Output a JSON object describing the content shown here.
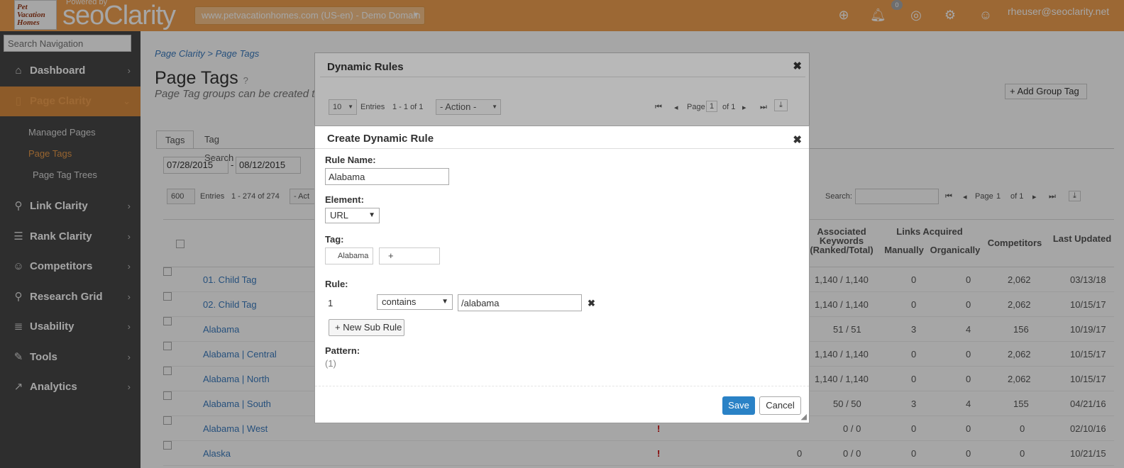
{
  "header": {
    "logo_text": "Pet Vacation Homes",
    "powered_by": "Powered by",
    "brand": "seoClarity",
    "domain": "www.petvacationhomes.com (US-en) - Demo Domain",
    "notification_count": "0",
    "user_email": "rheuser@seoclarity.net",
    "icons": [
      "plus-circle-icon",
      "bell-icon",
      "support-icon",
      "gear-icon",
      "user-icon"
    ]
  },
  "sidebar": {
    "search_placeholder": "Search Navigation",
    "items": [
      {
        "label": "Dashboard",
        "icon": "home-icon"
      },
      {
        "label": "Page Clarity",
        "icon": "page-icon",
        "active": true
      },
      {
        "label": "Link Clarity",
        "icon": "link-icon"
      },
      {
        "label": "Rank Clarity",
        "icon": "list-icon"
      },
      {
        "label": "Competitors",
        "icon": "users-icon"
      },
      {
        "label": "Research Grid",
        "icon": "search-icon"
      },
      {
        "label": "Usability",
        "icon": "database-icon"
      },
      {
        "label": "Tools",
        "icon": "wrench-icon"
      },
      {
        "label": "Analytics",
        "icon": "chart-icon"
      }
    ],
    "sub_items": [
      {
        "label": "Managed Pages"
      },
      {
        "label": "Page Tags",
        "active": true
      },
      {
        "label": "Page Tag Trees"
      }
    ]
  },
  "main": {
    "breadcrumb": "Page Clarity > Page Tags",
    "title": "Page Tags",
    "subtitle": "Page Tag groups can be created t",
    "add_group_label": "+ Add Group Tag",
    "tabs": [
      "Tags",
      "Tag Search"
    ],
    "date_from": "07/28/2015",
    "date_to": "08/12/2015",
    "date_sep": "-",
    "grid_entries_select": "600",
    "grid_entries_label": "Entries",
    "grid_range": "1 - 274 of 274",
    "grid_action": "- Act",
    "grid_search_label": "Search:",
    "grid_page_label": "Page",
    "grid_page": "1",
    "grid_of": "of 1",
    "columns": {
      "assoc_keywords": "Associated Keywords (Ranked/Total)",
      "links_acquired": "Links Acquired",
      "manually": "Manually",
      "organically": "Organically",
      "competitors": "Competitors",
      "last_updated": "Last Updated"
    },
    "rows": [
      {
        "name": "01. Child Tag",
        "flag": "",
        "assoc": "1,140 / 1,140",
        "manual": "0",
        "organic": "0",
        "competitors": "2,062",
        "updated": "03/13/18"
      },
      {
        "name": "02. Child Tag",
        "flag": "",
        "assoc": "1,140 / 1,140",
        "manual": "0",
        "organic": "0",
        "competitors": "2,062",
        "updated": "10/15/17"
      },
      {
        "name": "Alabama",
        "flag": "",
        "assoc": "51 / 51",
        "manual": "3",
        "organic": "4",
        "competitors": "156",
        "updated": "10/19/17"
      },
      {
        "name": "Alabama | Central",
        "flag": "",
        "assoc": "1,140 / 1,140",
        "manual": "0",
        "organic": "0",
        "competitors": "2,062",
        "updated": "10/15/17"
      },
      {
        "name": "Alabama | North",
        "flag": "",
        "assoc": "1,140 / 1,140",
        "manual": "0",
        "organic": "0",
        "competitors": "2,062",
        "updated": "10/15/17"
      },
      {
        "name": "Alabama | South",
        "flag": "",
        "assoc": "50 / 50",
        "manual": "3",
        "organic": "4",
        "competitors": "155",
        "updated": "04/21/16"
      },
      {
        "name": "Alabama | West",
        "flag": "!",
        "assoc": "0 / 0",
        "manual": "0",
        "organic": "0",
        "competitors": "0",
        "updated": "02/10/16"
      },
      {
        "name": "Alaska",
        "flag": "!",
        "extra": "0",
        "assoc": "0 / 0",
        "manual": "0",
        "organic": "0",
        "competitors": "0",
        "updated": "10/21/15"
      }
    ]
  },
  "dynamic_rules_modal": {
    "title": "Dynamic Rules",
    "entries_select": "10",
    "entries_label": "Entries",
    "range": "1 - 1 of 1",
    "action_select": "- Action -",
    "page_label": "Page",
    "page": "1",
    "of_label": "of 1"
  },
  "create_rule_modal": {
    "title": "Create Dynamic Rule",
    "rule_name_label": "Rule Name:",
    "rule_name_value": "Alabama",
    "element_label": "Element:",
    "element_value": "URL",
    "tag_label": "Tag:",
    "tag_value": "Alabama",
    "tag_add": "+",
    "rule_label": "Rule:",
    "rule_number": "1",
    "rule_operator": "contains",
    "rule_value": "/alabama",
    "new_sub_rule": "+ New Sub Rule",
    "pattern_label": "Pattern:",
    "pattern_value": "(1)",
    "save_label": "Save",
    "cancel_label": "Cancel"
  }
}
